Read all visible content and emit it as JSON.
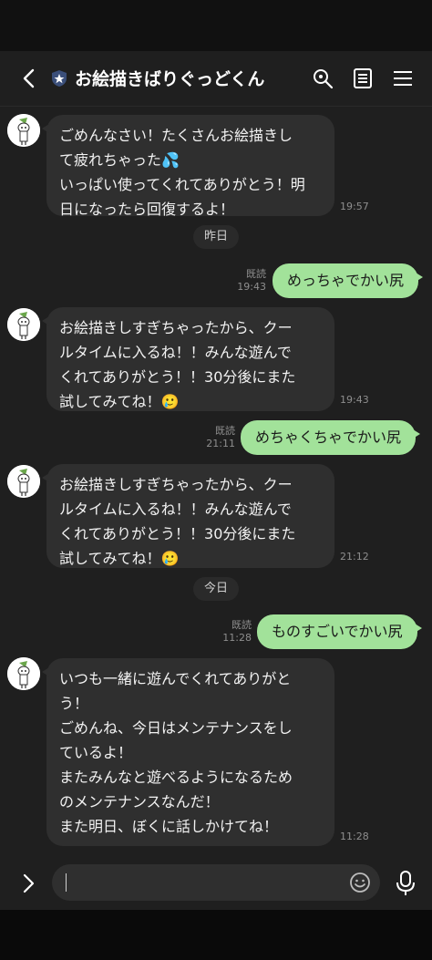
{
  "header": {
    "title": "お絵描きばりぐっどくん",
    "back_icon": "chevron-left-icon",
    "badge_icon": "official-shield-icon",
    "search_icon": "search-icon",
    "notes_icon": "notes-icon",
    "menu_icon": "hamburger-menu-icon"
  },
  "messages": {
    "m1": {
      "lines": [
        "ごめんなさい！たくさんお絵描きし",
        "て疲れちゃった💦",
        "いっぱい使ってくれてありがとう！明",
        "日になったら回復するよ！"
      ],
      "time": "19:57"
    },
    "d1": "昨日",
    "s1": {
      "text": "めっちゃでかい尻",
      "read": "既読",
      "time": "19:43"
    },
    "m2": {
      "lines": [
        "お絵描きしすぎちゃったから、クー",
        "ルタイムに入るね！！みんな遊んで",
        "くれてありがとう！！30分後にまた",
        "試してみてね！🥲"
      ],
      "time": "19:43"
    },
    "s2": {
      "text": "めちゃくちゃでかい尻",
      "read": "既読",
      "time": "21:11"
    },
    "m3": {
      "lines": [
        "お絵描きしすぎちゃったから、クー",
        "ルタイムに入るね！！みんな遊んで",
        "くれてありがとう！！30分後にまた",
        "試してみてね！🥲"
      ],
      "time": "21:12"
    },
    "d2": "今日",
    "s3": {
      "text": "ものすごいでかい尻",
      "read": "既読",
      "time": "11:28"
    },
    "m4": {
      "lines": [
        "いつも一緒に遊んでくれてありがと",
        "う！",
        "ごめんね、今日はメンテナンスをし",
        "ているよ！",
        "またみんなと遊べるようになるため",
        "のメンテナンスなんだ！",
        "また明日、ぼくに話しかけてね！"
      ],
      "time": "11:28"
    }
  },
  "composer": {
    "expand_icon": "chevron-right-icon",
    "placeholder": "",
    "emoji_icon": "emoji-icon",
    "mic_icon": "microphone-icon"
  },
  "colors": {
    "background": "#1f1f1f",
    "bubble_in": "#2f2f2f",
    "bubble_out": "#a2e29a"
  }
}
